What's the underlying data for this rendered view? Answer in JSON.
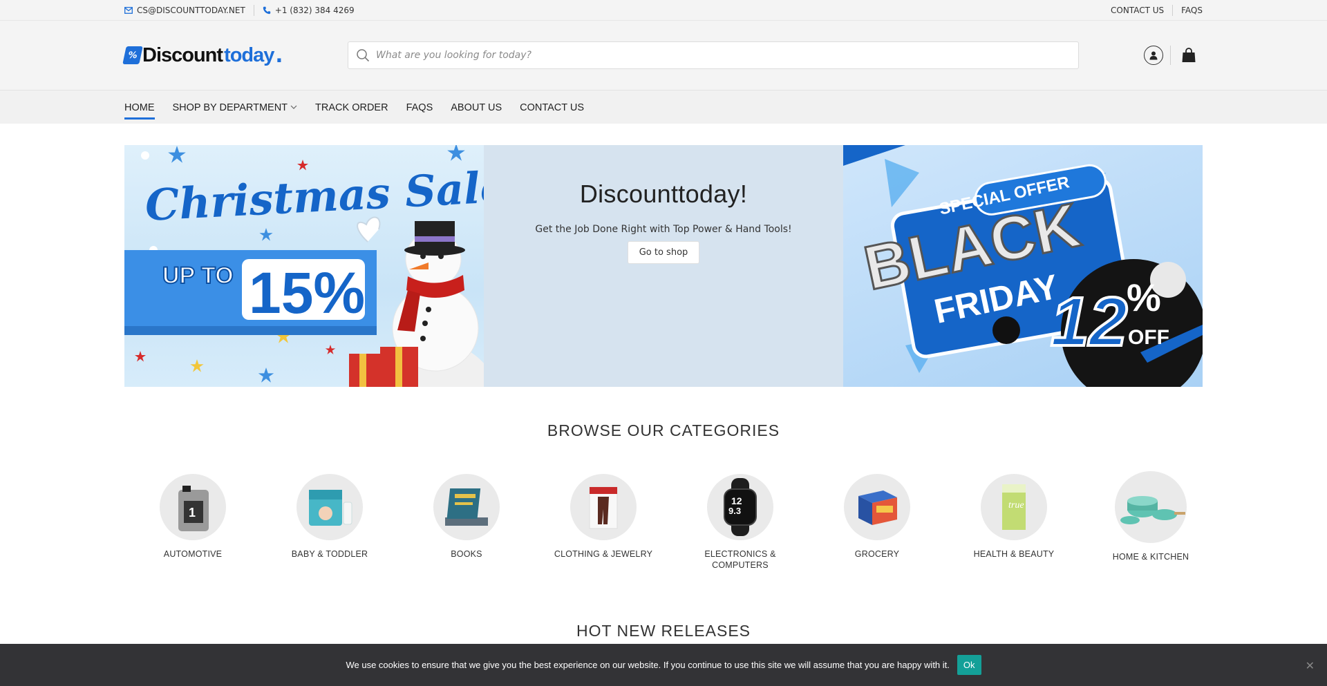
{
  "topbar": {
    "email": "CS@DISCOUNTTODAY.NET",
    "phone": "+1 (832) 384 4269",
    "links": [
      "CONTACT US",
      "FAQS"
    ]
  },
  "header": {
    "logo_part1": "Discount",
    "logo_part2": "today",
    "logo_dot": ".",
    "search_placeholder": "What are you looking for today?"
  },
  "nav": {
    "items": [
      "HOME",
      "SHOP BY DEPARTMENT",
      "TRACK ORDER",
      "FAQS",
      "ABOUT US",
      "CONTACT US"
    ]
  },
  "hero": {
    "xmas": {
      "title": "Christmas Sale",
      "prefix": "UP TO",
      "discount": "15%"
    },
    "middle": {
      "title": "Discounttoday!",
      "subtitle": "Get the Job Done Right with Top Power & Hand Tools!",
      "button": "Go to shop"
    },
    "blackfriday": {
      "badge": "SPECIAL OFFER",
      "word1": "BLACK",
      "word2": "FRIDAY",
      "number": "12",
      "percent": "%",
      "off": "OFF"
    }
  },
  "categories": {
    "title": "BROWSE OUR CATEGORIES",
    "items": [
      {
        "label": "AUTOMOTIVE",
        "icon": "motor-oil-icon"
      },
      {
        "label": "BABY & TODDLER",
        "icon": "diapers-icon"
      },
      {
        "label": "BOOKS",
        "icon": "books-icon"
      },
      {
        "label": "CLOTHING & JEWELRY",
        "icon": "clothing-icon"
      },
      {
        "label": "ELECTRONICS & COMPUTERS",
        "icon": "smartwatch-icon"
      },
      {
        "label": "GROCERY",
        "icon": "grocery-box-icon"
      },
      {
        "label": "HEALTH & BEAUTY",
        "icon": "supplement-box-icon"
      },
      {
        "label": "HOME & KITCHEN",
        "icon": "cookware-icon"
      }
    ]
  },
  "hot_new": {
    "title": "HOT NEW RELEASES"
  },
  "cookie": {
    "message": "We use cookies to ensure that we give you the best experience on our website. If you continue to use this site we will assume that you are happy with it.",
    "ok": "Ok",
    "close": "✕"
  },
  "colors": {
    "brand_blue": "#1e6fd9",
    "cookie_bg": "#333336",
    "ok_teal": "#14a098"
  }
}
